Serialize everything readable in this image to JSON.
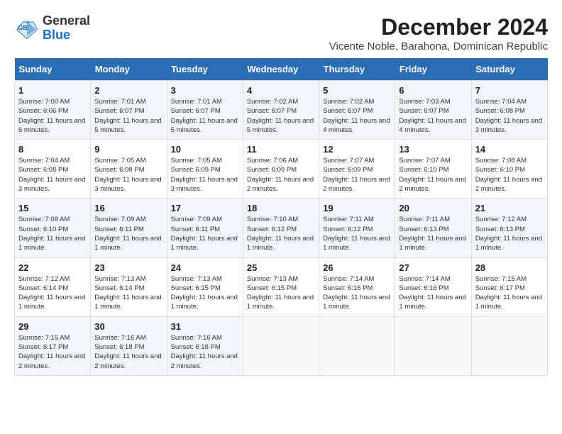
{
  "header": {
    "logo_line1": "General",
    "logo_line2": "Blue",
    "title": "December 2024",
    "subtitle": "Vicente Noble, Barahona, Dominican Republic"
  },
  "days_of_week": [
    "Sunday",
    "Monday",
    "Tuesday",
    "Wednesday",
    "Thursday",
    "Friday",
    "Saturday"
  ],
  "weeks": [
    [
      {
        "num": "1",
        "sunrise": "7:00 AM",
        "sunset": "6:06 PM",
        "daylight": "11 hours and 6 minutes."
      },
      {
        "num": "2",
        "sunrise": "7:01 AM",
        "sunset": "6:07 PM",
        "daylight": "11 hours and 5 minutes."
      },
      {
        "num": "3",
        "sunrise": "7:01 AM",
        "sunset": "6:07 PM",
        "daylight": "11 hours and 5 minutes."
      },
      {
        "num": "4",
        "sunrise": "7:02 AM",
        "sunset": "6:07 PM",
        "daylight": "11 hours and 5 minutes."
      },
      {
        "num": "5",
        "sunrise": "7:02 AM",
        "sunset": "6:07 PM",
        "daylight": "11 hours and 4 minutes."
      },
      {
        "num": "6",
        "sunrise": "7:03 AM",
        "sunset": "6:07 PM",
        "daylight": "11 hours and 4 minutes."
      },
      {
        "num": "7",
        "sunrise": "7:04 AM",
        "sunset": "6:08 PM",
        "daylight": "11 hours and 3 minutes."
      }
    ],
    [
      {
        "num": "8",
        "sunrise": "7:04 AM",
        "sunset": "6:08 PM",
        "daylight": "11 hours and 3 minutes."
      },
      {
        "num": "9",
        "sunrise": "7:05 AM",
        "sunset": "6:08 PM",
        "daylight": "11 hours and 3 minutes."
      },
      {
        "num": "10",
        "sunrise": "7:05 AM",
        "sunset": "6:09 PM",
        "daylight": "11 hours and 3 minutes."
      },
      {
        "num": "11",
        "sunrise": "7:06 AM",
        "sunset": "6:09 PM",
        "daylight": "11 hours and 2 minutes."
      },
      {
        "num": "12",
        "sunrise": "7:07 AM",
        "sunset": "6:09 PM",
        "daylight": "11 hours and 2 minutes."
      },
      {
        "num": "13",
        "sunrise": "7:07 AM",
        "sunset": "6:10 PM",
        "daylight": "11 hours and 2 minutes."
      },
      {
        "num": "14",
        "sunrise": "7:08 AM",
        "sunset": "6:10 PM",
        "daylight": "11 hours and 2 minutes."
      }
    ],
    [
      {
        "num": "15",
        "sunrise": "7:08 AM",
        "sunset": "6:10 PM",
        "daylight": "11 hours and 1 minute."
      },
      {
        "num": "16",
        "sunrise": "7:09 AM",
        "sunset": "6:11 PM",
        "daylight": "11 hours and 1 minute."
      },
      {
        "num": "17",
        "sunrise": "7:09 AM",
        "sunset": "6:11 PM",
        "daylight": "11 hours and 1 minute."
      },
      {
        "num": "18",
        "sunrise": "7:10 AM",
        "sunset": "6:12 PM",
        "daylight": "11 hours and 1 minute."
      },
      {
        "num": "19",
        "sunrise": "7:11 AM",
        "sunset": "6:12 PM",
        "daylight": "11 hours and 1 minute."
      },
      {
        "num": "20",
        "sunrise": "7:11 AM",
        "sunset": "6:13 PM",
        "daylight": "11 hours and 1 minute."
      },
      {
        "num": "21",
        "sunrise": "7:12 AM",
        "sunset": "6:13 PM",
        "daylight": "11 hours and 1 minute."
      }
    ],
    [
      {
        "num": "22",
        "sunrise": "7:12 AM",
        "sunset": "6:14 PM",
        "daylight": "11 hours and 1 minute."
      },
      {
        "num": "23",
        "sunrise": "7:13 AM",
        "sunset": "6:14 PM",
        "daylight": "11 hours and 1 minute."
      },
      {
        "num": "24",
        "sunrise": "7:13 AM",
        "sunset": "6:15 PM",
        "daylight": "11 hours and 1 minute."
      },
      {
        "num": "25",
        "sunrise": "7:13 AM",
        "sunset": "6:15 PM",
        "daylight": "11 hours and 1 minute."
      },
      {
        "num": "26",
        "sunrise": "7:14 AM",
        "sunset": "6:16 PM",
        "daylight": "11 hours and 1 minute."
      },
      {
        "num": "27",
        "sunrise": "7:14 AM",
        "sunset": "6:16 PM",
        "daylight": "11 hours and 1 minute."
      },
      {
        "num": "28",
        "sunrise": "7:15 AM",
        "sunset": "6:17 PM",
        "daylight": "11 hours and 1 minute."
      }
    ],
    [
      {
        "num": "29",
        "sunrise": "7:15 AM",
        "sunset": "6:17 PM",
        "daylight": "11 hours and 2 minutes."
      },
      {
        "num": "30",
        "sunrise": "7:16 AM",
        "sunset": "6:18 PM",
        "daylight": "11 hours and 2 minutes."
      },
      {
        "num": "31",
        "sunrise": "7:16 AM",
        "sunset": "6:18 PM",
        "daylight": "11 hours and 2 minutes."
      },
      null,
      null,
      null,
      null
    ]
  ]
}
